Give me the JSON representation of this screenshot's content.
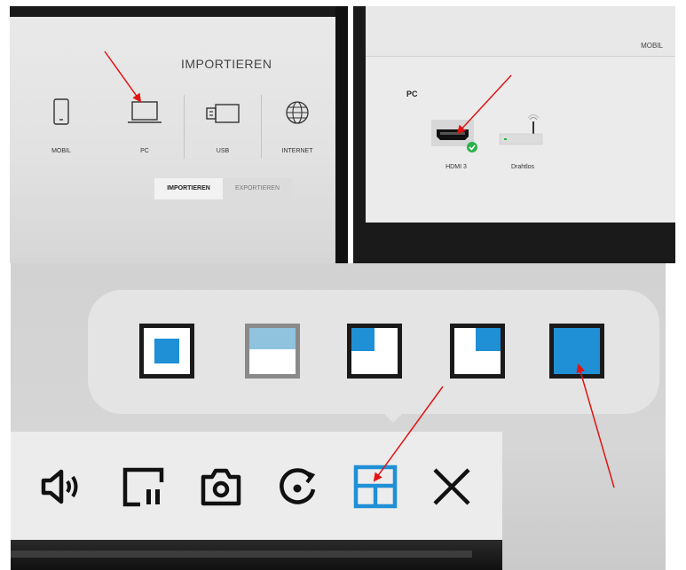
{
  "import_menu": {
    "title": "IMPORTIEREN",
    "items": [
      {
        "label": "MOBIL",
        "icon": "smartphone-icon"
      },
      {
        "label": "PC",
        "icon": "laptop-icon"
      },
      {
        "label": "USB",
        "icon": "usb-icon"
      },
      {
        "label": "INTERNET",
        "icon": "globe-icon"
      }
    ],
    "tabs": [
      {
        "label": "IMPORTIEREN",
        "active": true
      },
      {
        "label": "EXPORTIEREN",
        "active": false
      }
    ]
  },
  "pc_sources": {
    "header": "MOBIL",
    "section_title": "PC",
    "sources": [
      {
        "label": "HDMI 3",
        "icon": "hdmi-icon",
        "connected": true
      },
      {
        "label": "Drahtlos",
        "icon": "wireless-router-icon",
        "connected": false
      }
    ]
  },
  "toolbar": {
    "layout_options": [
      {
        "name": "layout-center-small",
        "icon": "pip-center-icon"
      },
      {
        "name": "layout-top-half",
        "icon": "split-top-icon"
      },
      {
        "name": "layout-top-left",
        "icon": "pip-top-left-icon"
      },
      {
        "name": "layout-top-right",
        "icon": "pip-top-right-icon"
      },
      {
        "name": "layout-full",
        "icon": "fullscreen-blue-icon"
      }
    ],
    "tools": [
      {
        "name": "volume",
        "icon": "volume-icon"
      },
      {
        "name": "pause-screen",
        "icon": "screen-pause-icon"
      },
      {
        "name": "capture",
        "icon": "camera-icon"
      },
      {
        "name": "rotate",
        "icon": "rotate-icon"
      },
      {
        "name": "layout",
        "icon": "grid-layout-icon",
        "active": true
      },
      {
        "name": "close",
        "icon": "close-icon"
      }
    ]
  },
  "colors": {
    "accent_blue": "#1f8fd6",
    "arrow_red": "#e11414",
    "ok_green": "#2bb24c"
  }
}
